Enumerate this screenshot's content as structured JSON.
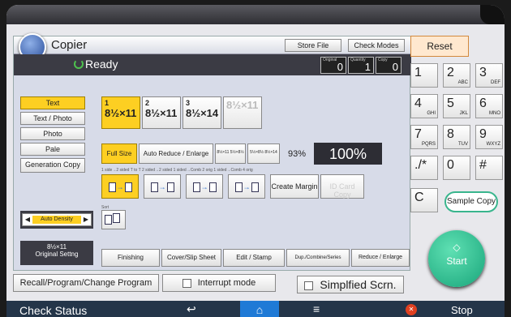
{
  "header": {
    "title": "Copier",
    "store_file": "Store File",
    "check_modes": "Check Modes"
  },
  "status": {
    "text": "Ready",
    "counters": [
      {
        "label": "Original",
        "value": "0"
      },
      {
        "label": "Quantity",
        "value": "1"
      },
      {
        "label": "Copy",
        "value": "0"
      }
    ]
  },
  "left_menu": [
    "Text",
    "Text / Photo",
    "Photo",
    "Pale",
    "Generation Copy"
  ],
  "paper": [
    {
      "num": "1",
      "size": "8½×11"
    },
    {
      "num": "2",
      "size": "8½×11"
    },
    {
      "num": "3",
      "size": "8½×14"
    },
    {
      "num": "",
      "size": "8½×11"
    }
  ],
  "reduce": {
    "full_size": "Full Size",
    "auto": "Auto Reduce / Enlarge",
    "r1": "8½×11 5½×8½",
    "r2": "5½×8½ 8½×14",
    "ratio": "93%",
    "percent": "100%"
  },
  "duplex": {
    "labels": "1 side→2 sided T to T   2 sided→2 sided   1 sided→Comb 2 orig 1 sided→Comb 4 orig",
    "create_margin": "Create Margin",
    "id_card": "ID Card Copy"
  },
  "sort_label": "Sort",
  "density": {
    "label": "Auto Density"
  },
  "original_settings": {
    "size": "8½×11",
    "label": "Original Settng"
  },
  "tabs": [
    "Finishing",
    "Cover/Slip Sheet",
    "Edit / Stamp",
    "Dup./Combine/Series",
    "Reduce / Enlarge"
  ],
  "bottom": {
    "recall": "Recall/Program/Change Program",
    "interrupt": "Interrupt mode",
    "simplified": "Simplfied Scrn."
  },
  "keypad": {
    "reset": "Reset",
    "keys": [
      {
        "k": "1",
        "s": ""
      },
      {
        "k": "2",
        "s": "ABC"
      },
      {
        "k": "3",
        "s": "DEF"
      },
      {
        "k": "4",
        "s": "GHI"
      },
      {
        "k": "5",
        "s": "JKL"
      },
      {
        "k": "6",
        "s": "MNO"
      },
      {
        "k": "7",
        "s": "PQRS"
      },
      {
        "k": "8",
        "s": "TUV"
      },
      {
        "k": "9",
        "s": "WXYZ"
      },
      {
        "k": "./*",
        "s": ""
      },
      {
        "k": "0",
        "s": ""
      },
      {
        "k": "#",
        "s": ""
      }
    ],
    "clear": "C",
    "sample_copy": "Sample Copy",
    "start": "Start"
  },
  "navbar": {
    "check_status": "Check Status",
    "stop": "Stop"
  }
}
